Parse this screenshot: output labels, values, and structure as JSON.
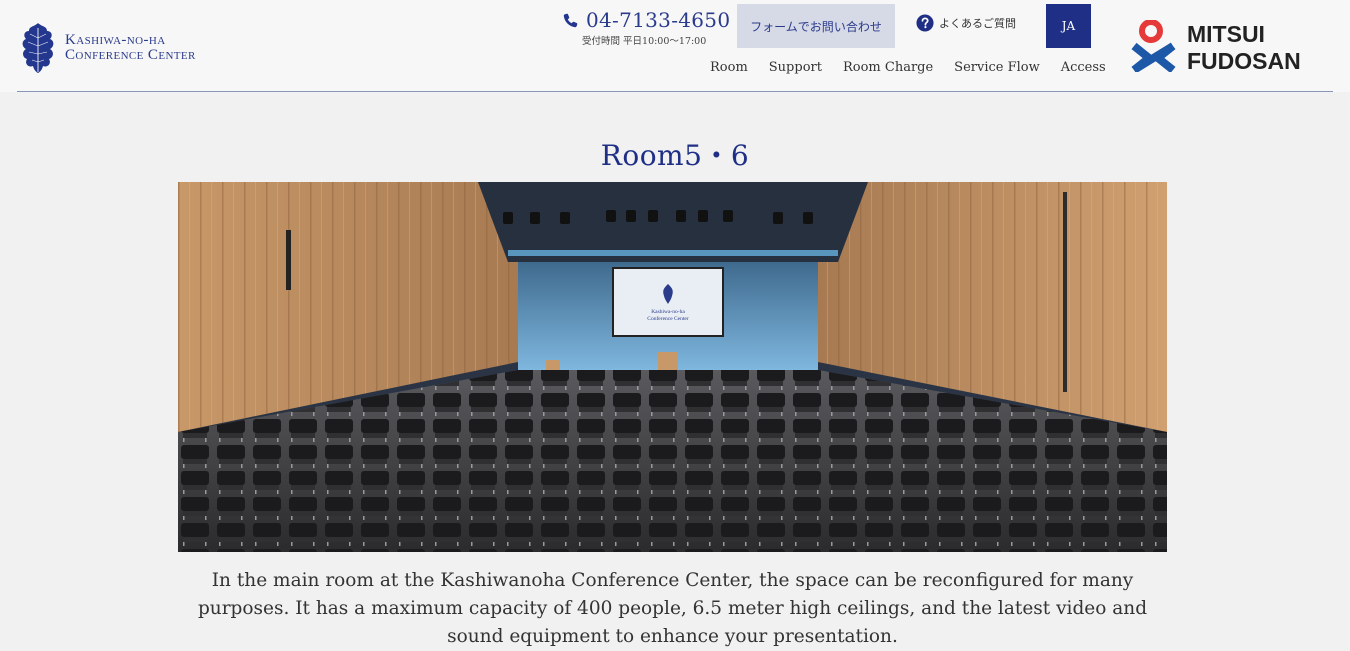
{
  "brand": {
    "line1": "Kashiwa-no-ha",
    "line2": "Conference Center"
  },
  "header": {
    "phone": "04-7133-4650",
    "hours": "受付時間 平日10:00〜17:00",
    "form_button": "フォームでお問い合わせ",
    "faq": "よくあるご質問",
    "lang": "JA"
  },
  "nav": {
    "items": [
      "Room",
      "Support",
      "Room Charge",
      "Service Flow",
      "Access"
    ]
  },
  "partner_logo": {
    "line1": "MITSUI",
    "line2": "FUDOSAN"
  },
  "main": {
    "title": "Room5・6",
    "screen_line1": "Kashiwa-no-ha",
    "screen_line2": "Conference Center",
    "description": "In the main room at the Kashiwanoha Conference Center, the space can be reconfigured for many purposes. It has a maximum capacity of 400 people, 6.5 meter high ceilings, and the latest video and sound equipment to enhance your presentation."
  },
  "colors": {
    "brand_navy": "#1f2f86",
    "logo_red": "#e63a3a",
    "logo_blue": "#1d58a8"
  },
  "icons": {
    "phone": "phone-icon",
    "faq": "question-circle-icon",
    "brand": "oak-leaf-icon"
  }
}
